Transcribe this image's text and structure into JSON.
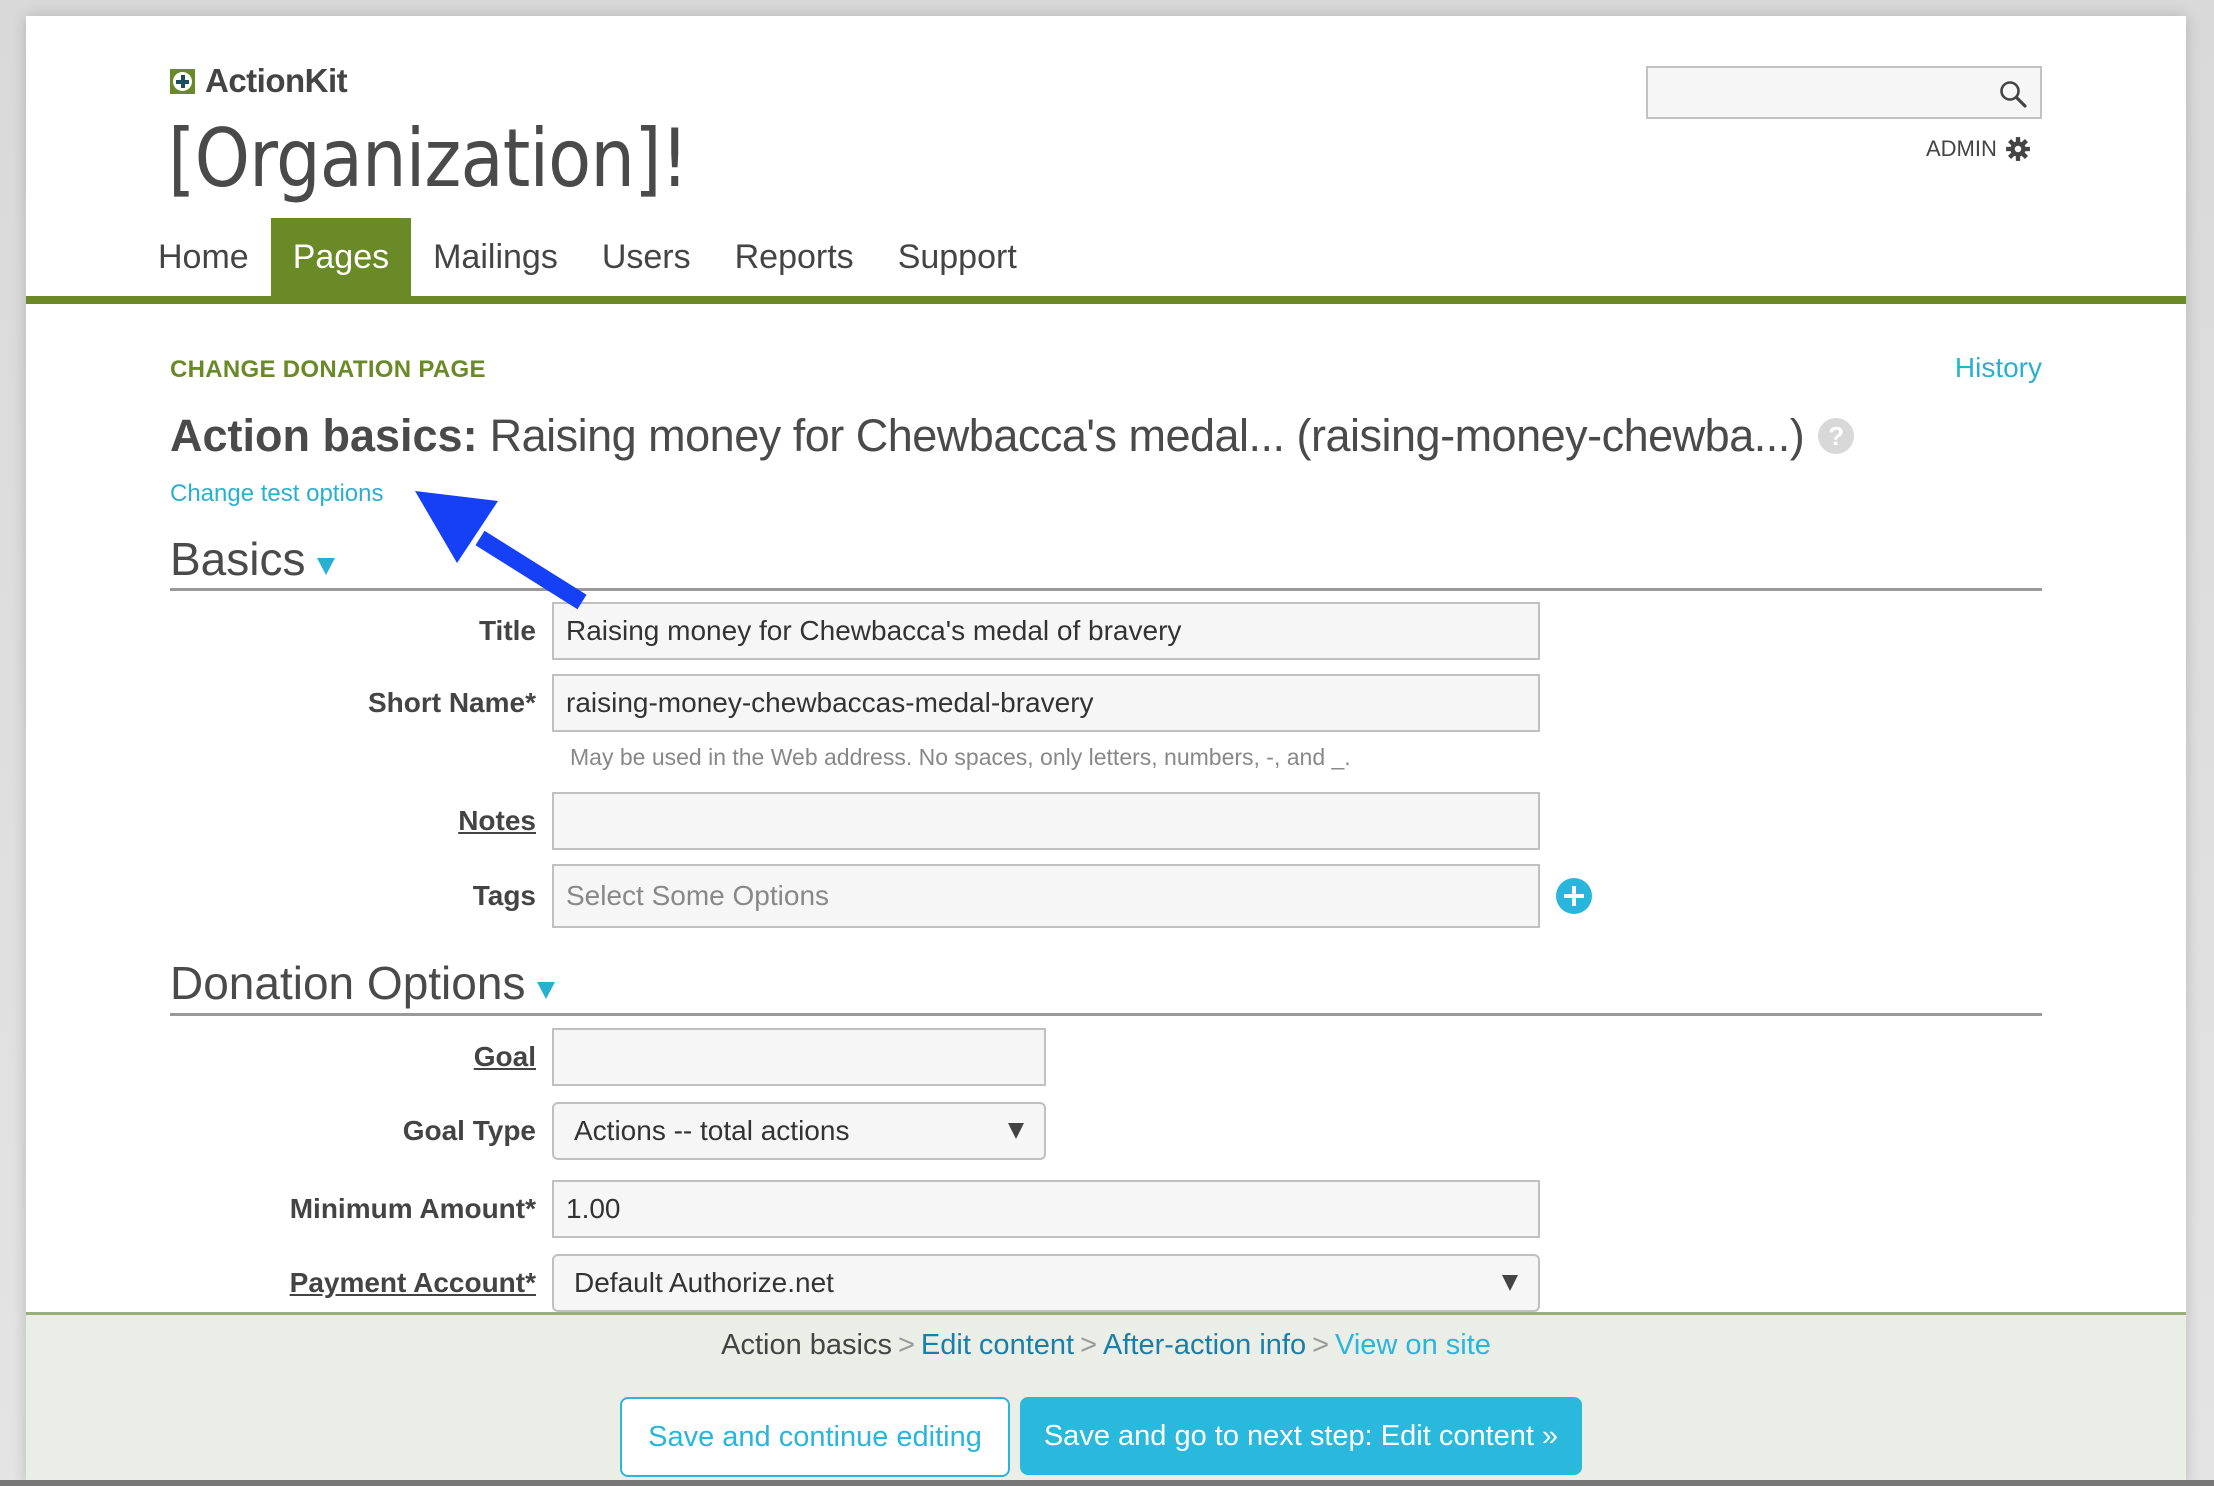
{
  "header": {
    "brand": "ActionKit",
    "org_title": "[Organization]!",
    "search": {
      "value": "",
      "placeholder": ""
    },
    "admin_label": "ADMIN"
  },
  "nav": {
    "tabs": [
      {
        "label": "Home",
        "active": false
      },
      {
        "label": "Pages",
        "active": true
      },
      {
        "label": "Mailings",
        "active": false
      },
      {
        "label": "Users",
        "active": false
      },
      {
        "label": "Reports",
        "active": false
      },
      {
        "label": "Support",
        "active": false
      }
    ]
  },
  "page": {
    "section_label": "CHANGE DONATION PAGE",
    "history_link": "History",
    "heading_bold": "Action basics:",
    "heading_rest": "Raising money for Chewbacca's medal... (raising-money-chewba...)",
    "help_icon_glyph": "?",
    "change_test_options": "Change test options"
  },
  "basics": {
    "title": "Basics",
    "fields": {
      "title": {
        "label": "Title",
        "value": "Raising money for Chewbacca's medal of bravery"
      },
      "short_name": {
        "label": "Short Name*",
        "value": "raising-money-chewbaccas-medal-bravery",
        "hint": "May be used in the Web address. No spaces, only letters, numbers, -, and _."
      },
      "notes": {
        "label": "Notes",
        "value": ""
      },
      "tags": {
        "label": "Tags",
        "placeholder": "Select Some Options"
      }
    }
  },
  "donation_options": {
    "title": "Donation Options",
    "fields": {
      "goal": {
        "label": "Goal",
        "value": ""
      },
      "goal_type": {
        "label": "Goal Type",
        "selected": "Actions -- total actions"
      },
      "minimum_amount": {
        "label": "Minimum Amount*",
        "value": "1.00"
      },
      "payment_account": {
        "label": "Payment Account*",
        "selected": "Default Authorize.net"
      }
    }
  },
  "footer": {
    "steps": [
      {
        "label": "Action basics",
        "state": "current"
      },
      {
        "label": "Edit content",
        "state": "link"
      },
      {
        "label": "After-action info",
        "state": "link"
      },
      {
        "label": "View on site",
        "state": "view"
      }
    ],
    "separator": ">",
    "save_continue": "Save and continue editing",
    "save_next": "Save and go to next step: Edit content »"
  },
  "colors": {
    "brand_green": "#6a8a27",
    "link_blue": "#2ab0d0",
    "button_blue": "#2ab8dc",
    "annotation_arrow": "#1540f5"
  }
}
